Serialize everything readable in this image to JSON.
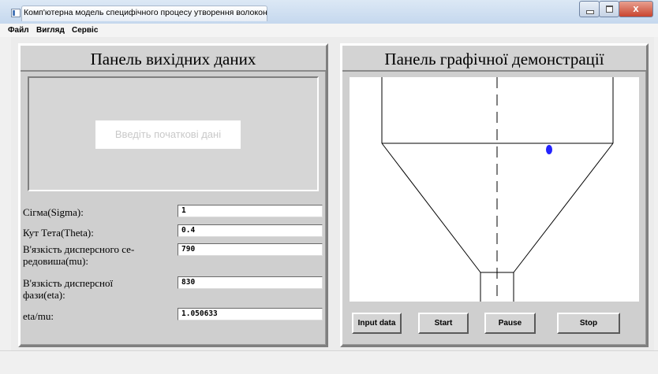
{
  "window": {
    "title": "Комп'ютерна модель специфічного процесу утворення волокон",
    "close_symbol": "x"
  },
  "menu": {
    "items": [
      {
        "label": "Файл"
      },
      {
        "label": "Вигляд"
      },
      {
        "label": "Сервіс"
      }
    ]
  },
  "input_panel": {
    "title": "Панель вихідних даних",
    "message": "Введіть початкові дані",
    "fields": [
      {
        "label": "Сігма(Sigma):",
        "value": "1"
      },
      {
        "label": "Кут Тета(Theta):",
        "value": "0.4"
      },
      {
        "label": "В'язкість дисперсного се-редовиша(mu):",
        "value": "790"
      },
      {
        "label": "В'язкість дисперсної фази(eta):",
        "value": "830"
      },
      {
        "label": "eta/mu:",
        "value": "1.050633"
      }
    ]
  },
  "graphic_panel": {
    "title": "Панель графічної демонстрації",
    "particle_color": "#2323ff",
    "buttons": {
      "input_data": "Input data",
      "start": "Start",
      "pause": "Pause",
      "stop": "Stop"
    }
  }
}
